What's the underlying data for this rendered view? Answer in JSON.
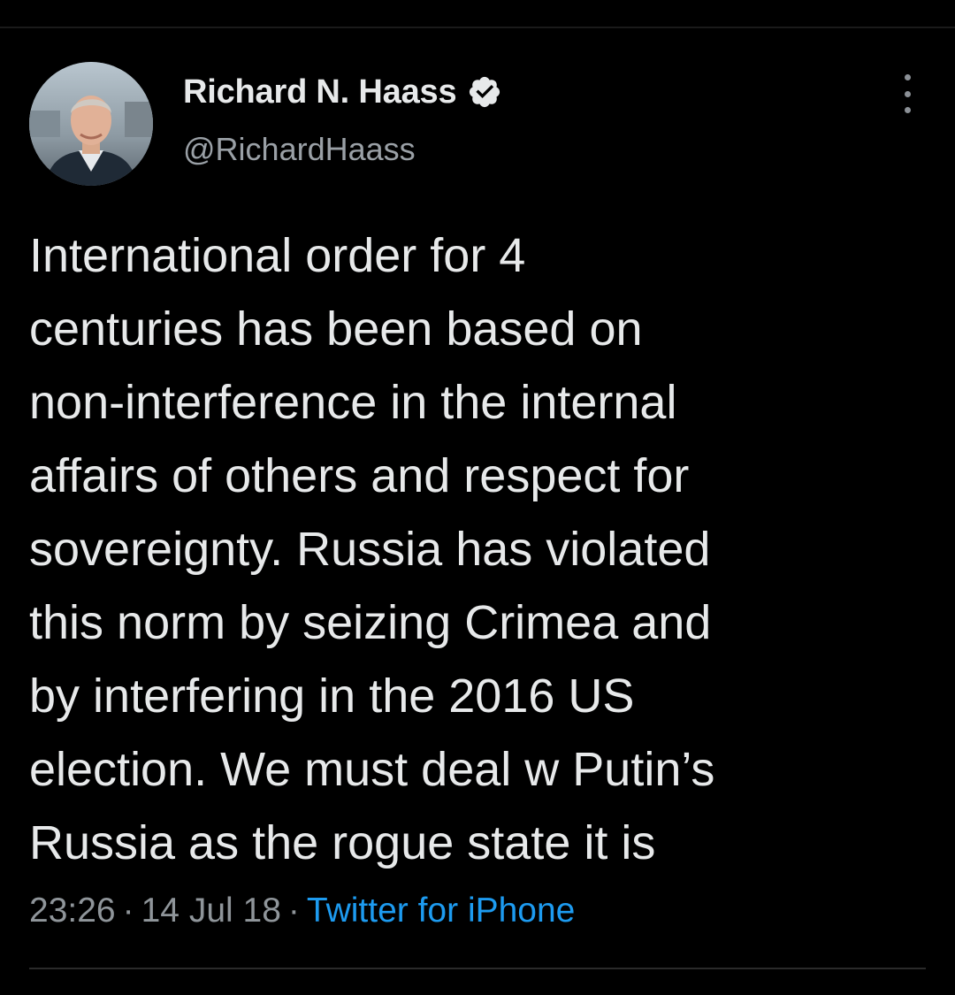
{
  "author": {
    "display_name": "Richard N. Haass",
    "handle": "@RichardHaass",
    "verified": true,
    "avatar_icon": "profile-photo"
  },
  "menu": {
    "icon": "more-vertical-icon"
  },
  "tweet": {
    "lines": [
      "International order for 4",
      "centuries has been based on",
      "non-interference in the internal",
      "affairs of others and respect for",
      "sovereignty. Russia has violated",
      "this norm by seizing Crimea and",
      "by interfering in the 2016 US",
      "election. We must deal w Putin’s",
      "Russia as the rogue state it is"
    ]
  },
  "meta": {
    "time": "23:26",
    "separator": "·",
    "date": "14 Jul 18",
    "source": "Twitter for iPhone"
  },
  "colors": {
    "background": "#000000",
    "text_primary": "#e7e9ea",
    "text_secondary": "#8f959a",
    "link": "#1d9bf0",
    "verified_badge": "#e7e9ea"
  }
}
